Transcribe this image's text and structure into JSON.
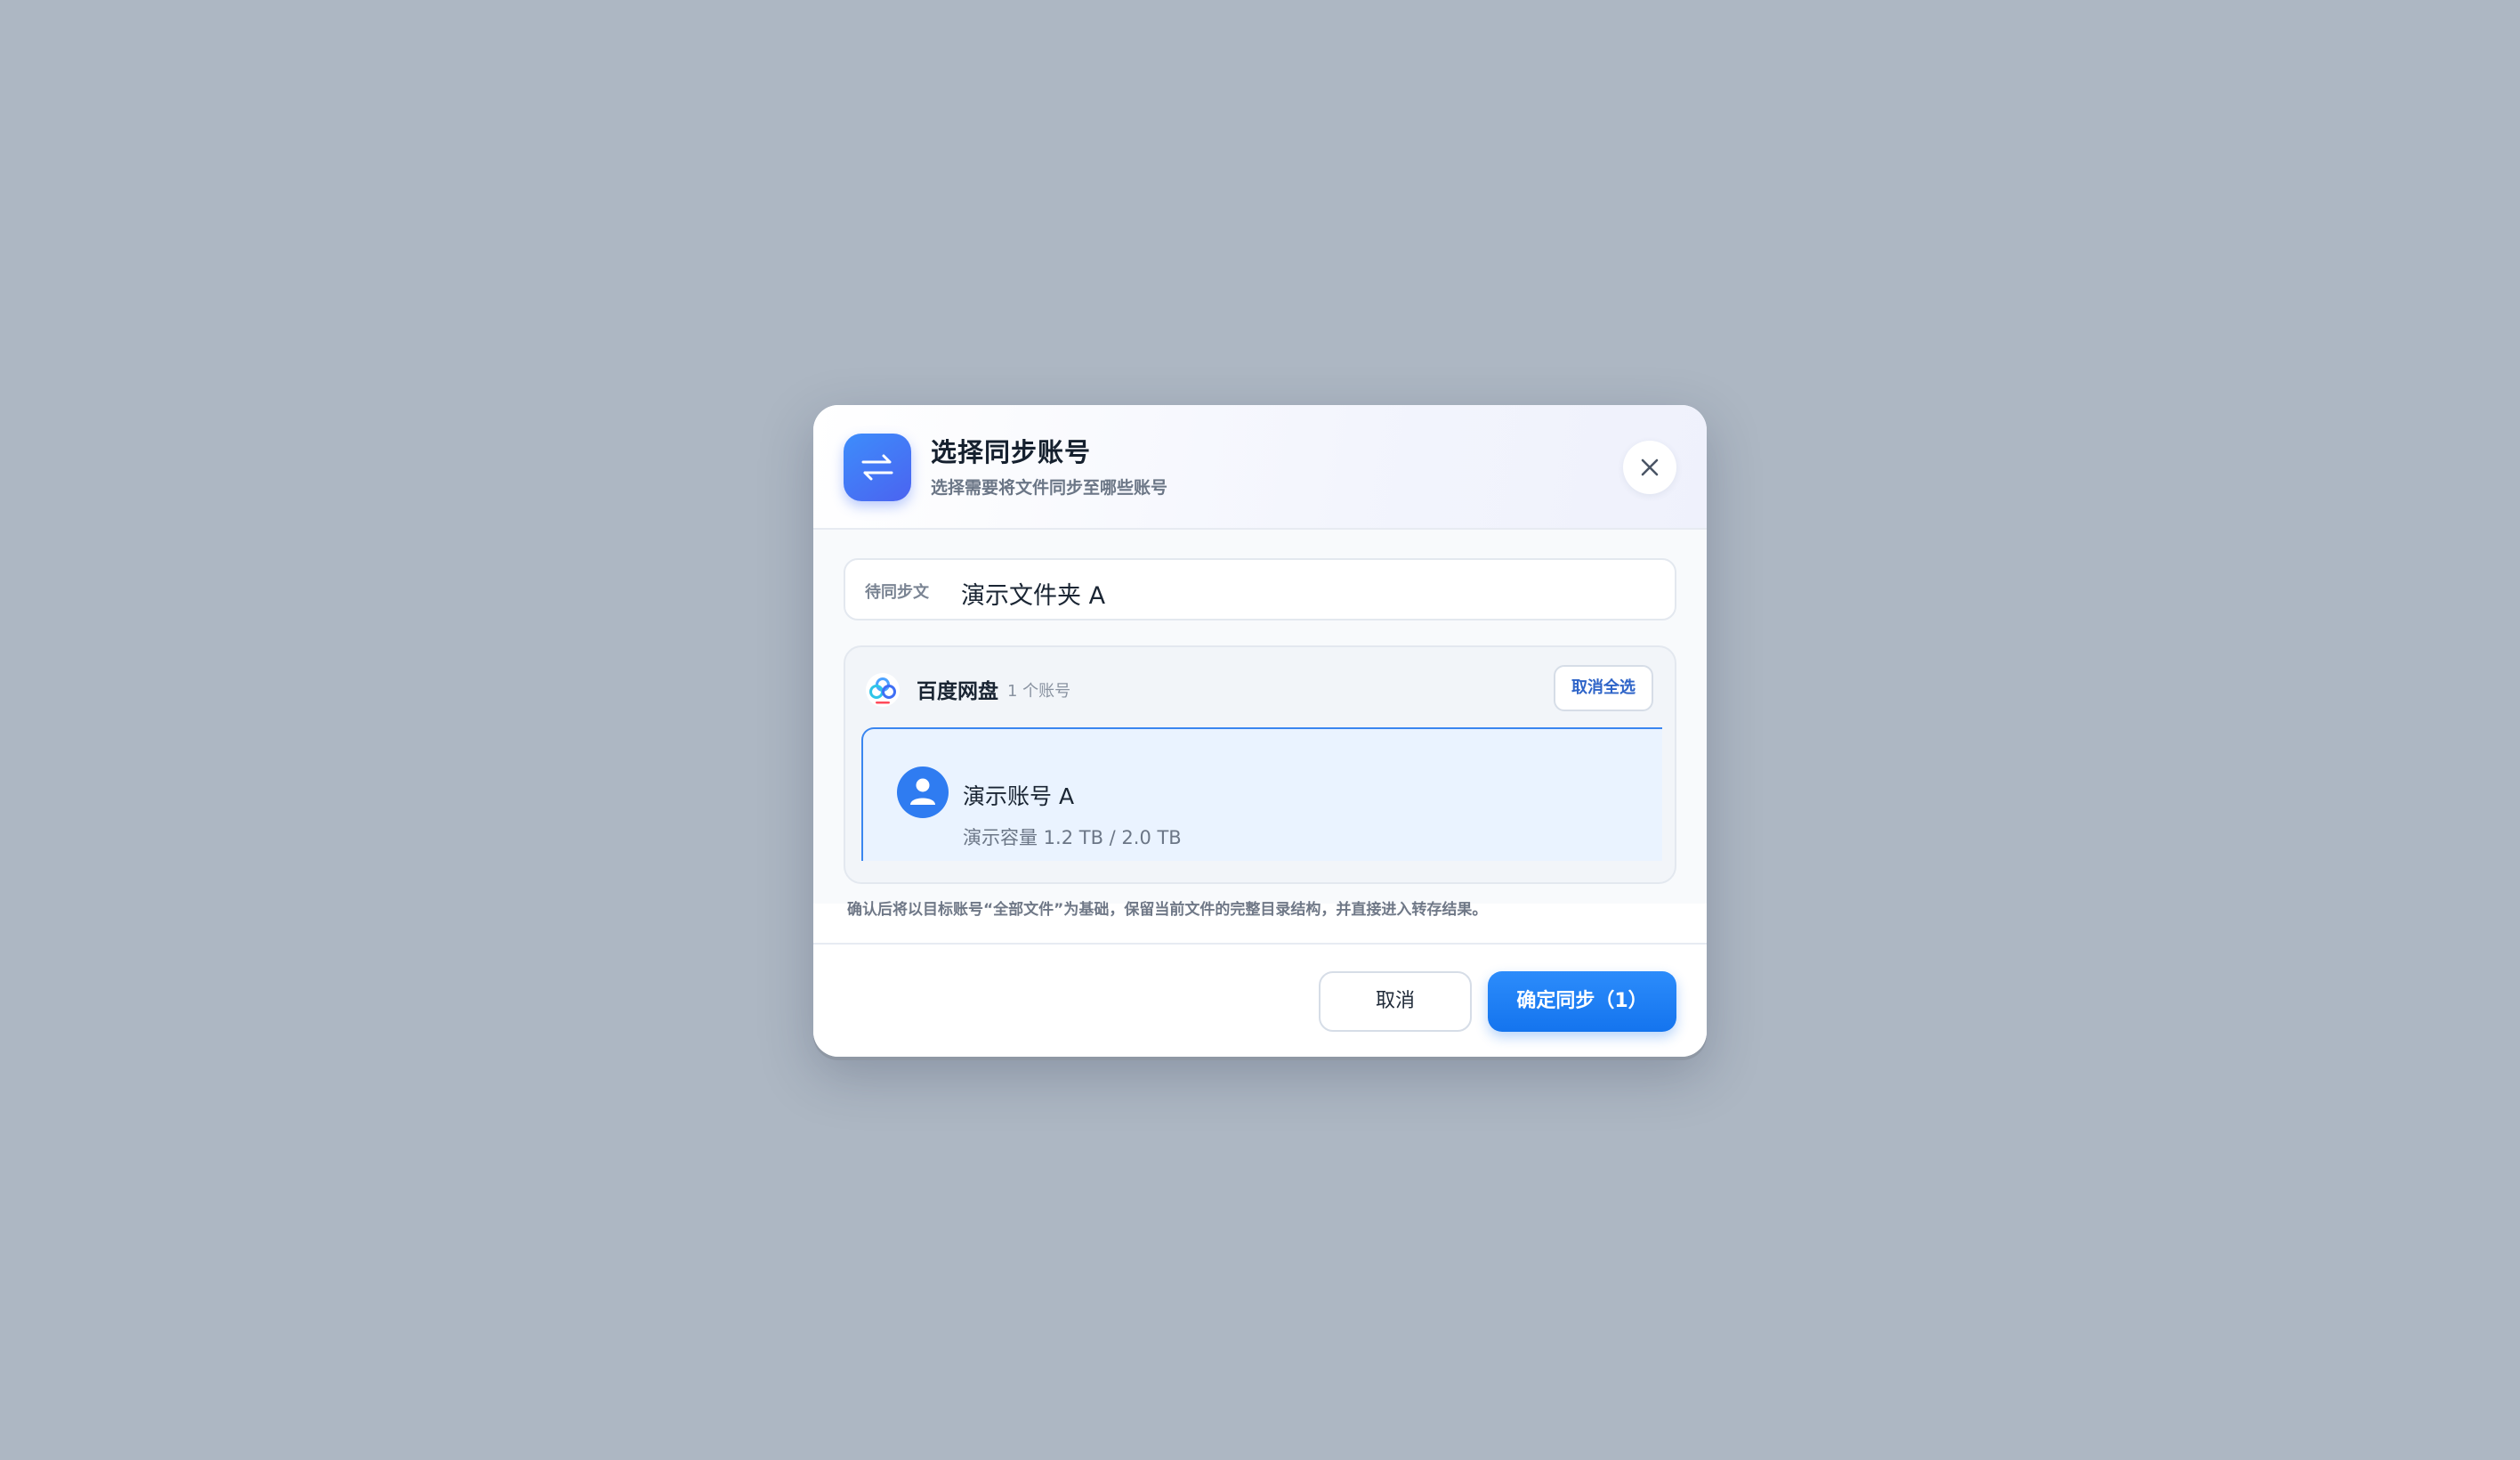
{
  "dialog": {
    "title": "选择同步账号",
    "subtitle": "选择需要将文件同步至哪些账号",
    "icon": "swap-arrows-icon",
    "close_icon": "close-icon"
  },
  "file": {
    "label": "待同步文",
    "name": "演示文件夹 A"
  },
  "provider": {
    "name": "百度网盘",
    "count": "1 个账号",
    "deselect_label": "取消全选",
    "logo": "baidu-netdisk-logo"
  },
  "account": {
    "name": "演示账号 A",
    "storage": "演示容量 1.2 TB / 2.0 TB",
    "selected": true
  },
  "hint": "确认后将以目标账号“全部文件”为基础，保留当前文件的完整目录结构，并直接进入转存结果。",
  "footer": {
    "cancel_label": "取消",
    "confirm_label": "确定同步（1）"
  },
  "colors": {
    "accent": "#1474ee",
    "backdrop": "#adb7c3",
    "selected_card": "#eaf3ff"
  }
}
